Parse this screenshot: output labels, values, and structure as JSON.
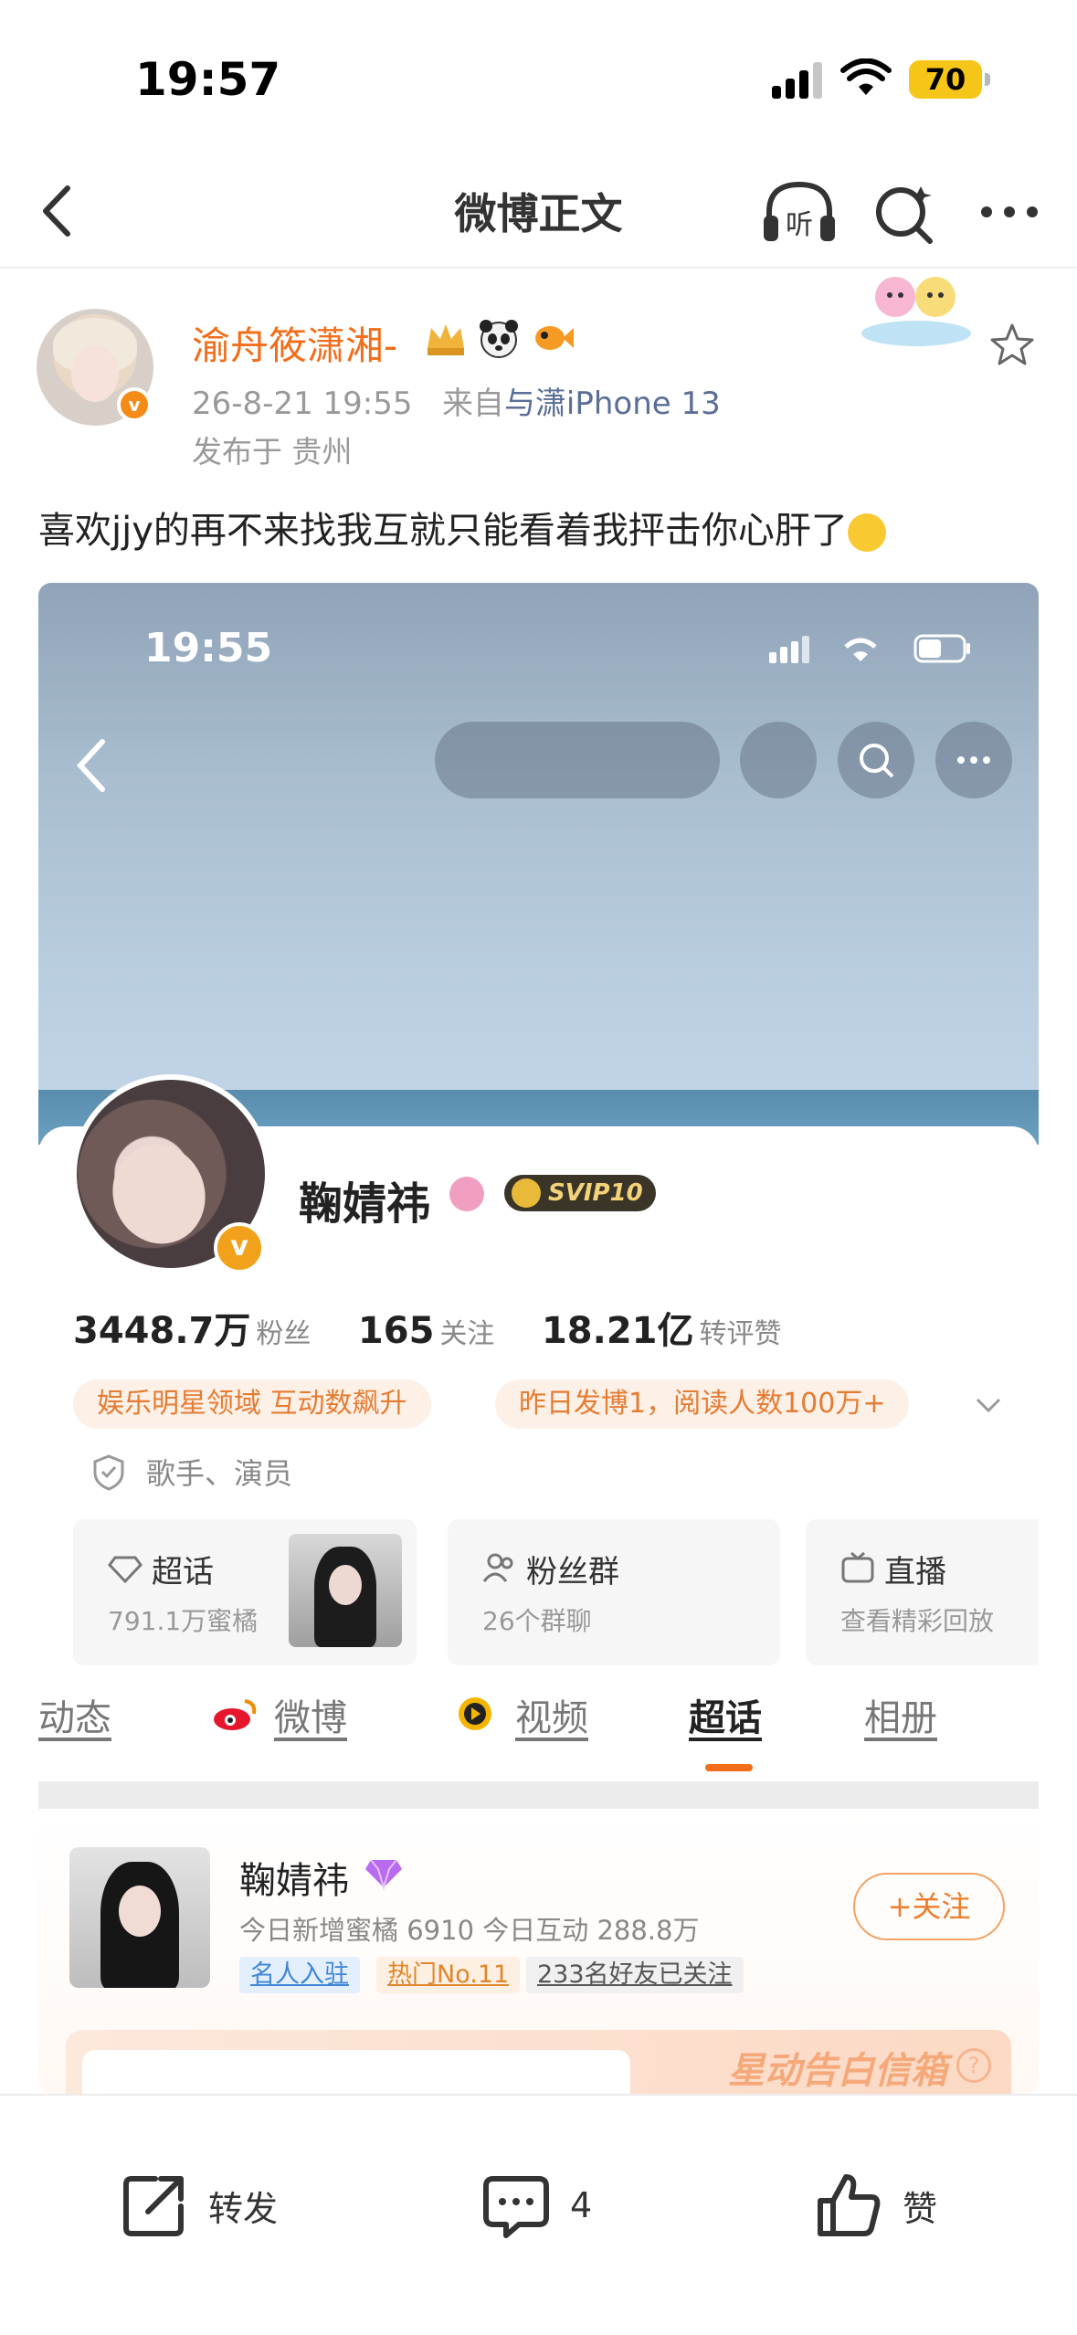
{
  "status_bar": {
    "time": "19:57",
    "battery": "70"
  },
  "nav": {
    "title": "微博正文",
    "listen_label": "听"
  },
  "post": {
    "username": "渝舟筱潇湘-",
    "timestamp": "26-8-21 19:55",
    "source_prefix": "来自",
    "device": "与潇iPhone 13",
    "location": "发布于 贵州",
    "text": "喜欢jjy的再不来找我互就只能看着我抨击你心肝了"
  },
  "embed": {
    "time": "19:55",
    "profile": {
      "name": "鞠婧祎",
      "vip_label": "SVIP10",
      "followers": "3448.7万",
      "followers_label": "粉丝",
      "following": "165",
      "following_label": "关注",
      "likes": "18.21亿",
      "likes_label": "转评赞",
      "tags": [
        "娱乐明星领域 互动数飙升",
        "昨日发博1，阅读人数100万+"
      ],
      "role": "歌手、演员"
    },
    "features": [
      {
        "title": "超话",
        "sub": "791.1万蜜橘"
      },
      {
        "title": "粉丝群",
        "sub": "26个群聊"
      },
      {
        "title": "直播",
        "sub": "查看精彩回放"
      }
    ],
    "tabs": [
      "动态",
      "微博",
      "视频",
      "超话",
      "相册"
    ],
    "active_tab": "超话",
    "supertopic": {
      "name": "鞠婧祎",
      "stats": "今日新增蜜橘 6910 今日互动 288.8万",
      "chips": [
        "名人入驻",
        "热门No.11",
        "233名好友已关注"
      ],
      "follow_label": "+关注",
      "banner": "星动告白信箱"
    }
  },
  "actions": {
    "repost": "转发",
    "comment_count": "4",
    "like": "赞"
  },
  "colors": {
    "accent": "#f26e1a",
    "username": "#f26e1a",
    "device_link": "#5a6e96"
  }
}
